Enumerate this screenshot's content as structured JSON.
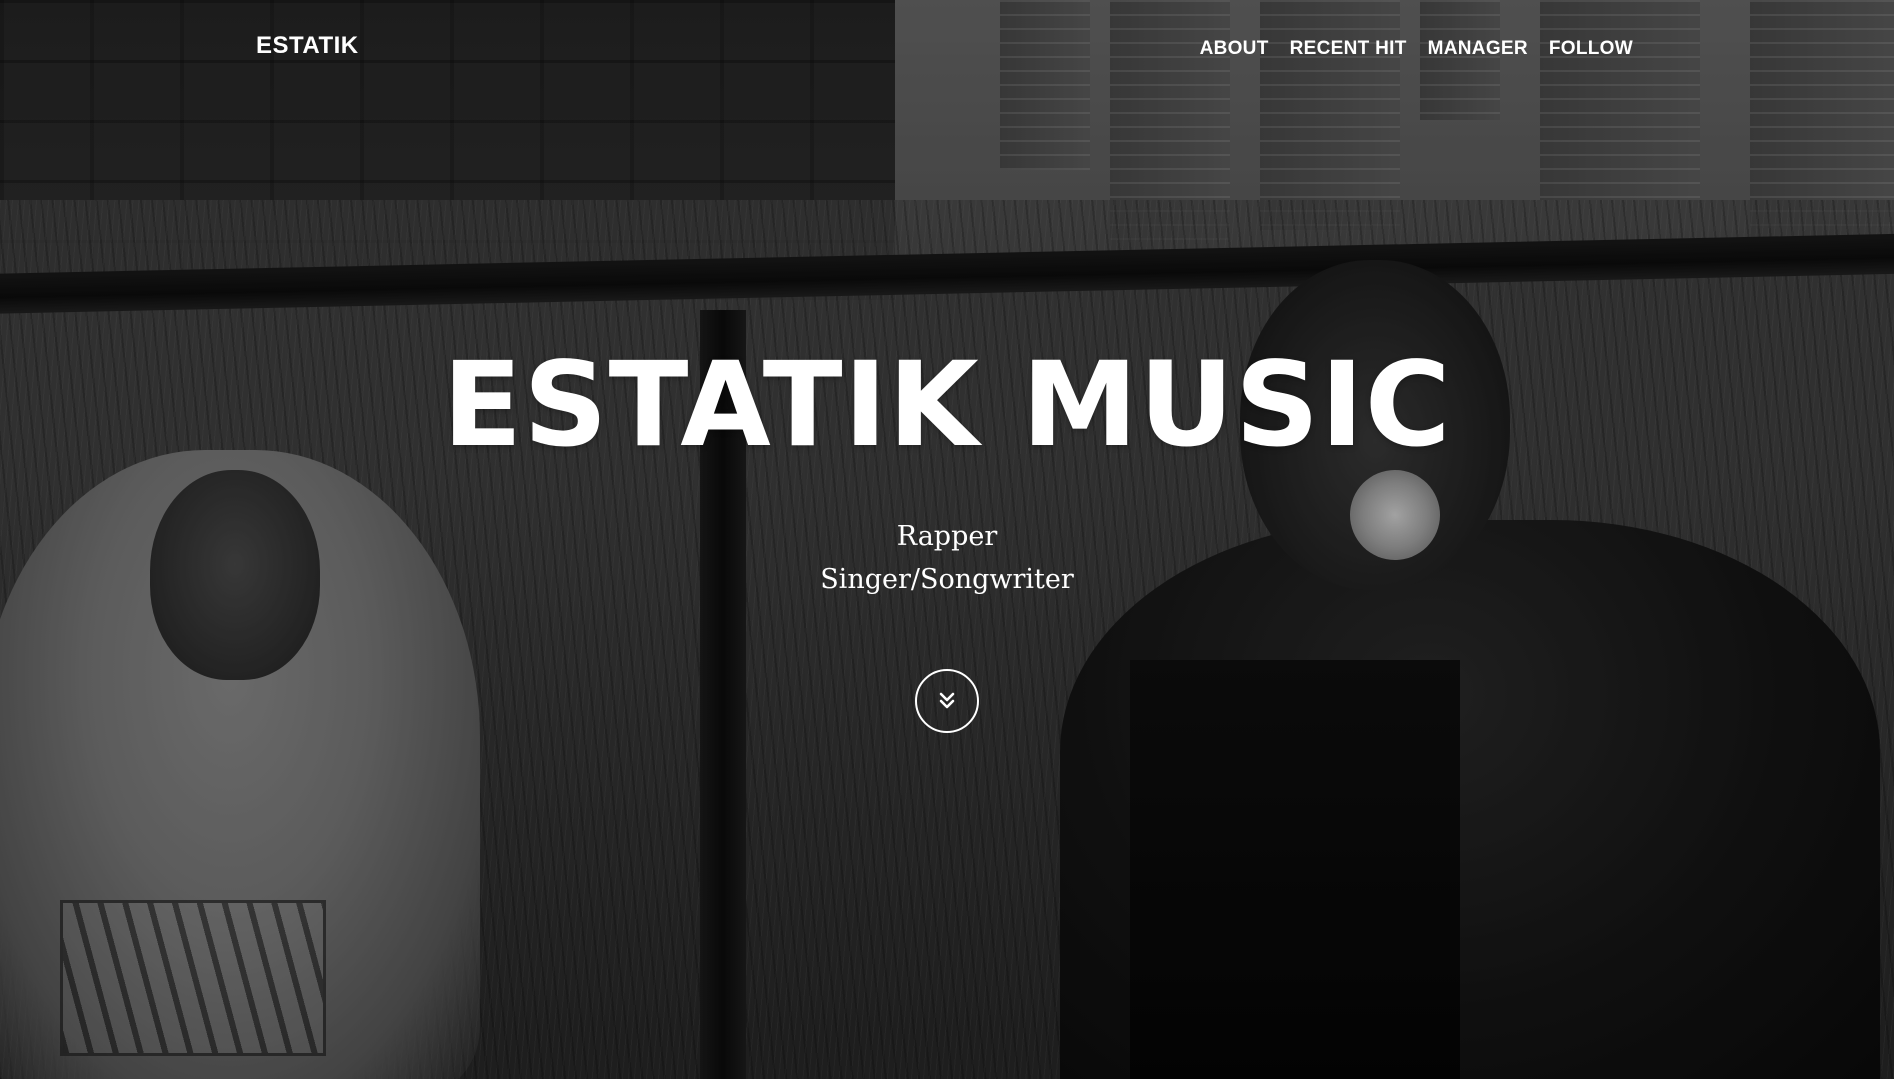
{
  "nav": {
    "brand": "ESTATIK",
    "links": [
      {
        "label": "ABOUT"
      },
      {
        "label": "RECENT HIT"
      },
      {
        "label": "MANAGER"
      },
      {
        "label": "FOLLOW"
      }
    ]
  },
  "hero": {
    "title": "ESTATIK MUSIC",
    "subtitle_lines": [
      "Rapper",
      "Singer/Songwriter"
    ],
    "scroll_icon": "double-chevron-down-icon"
  },
  "colors": {
    "text": "#ffffff",
    "background": "#3a3a3a"
  }
}
